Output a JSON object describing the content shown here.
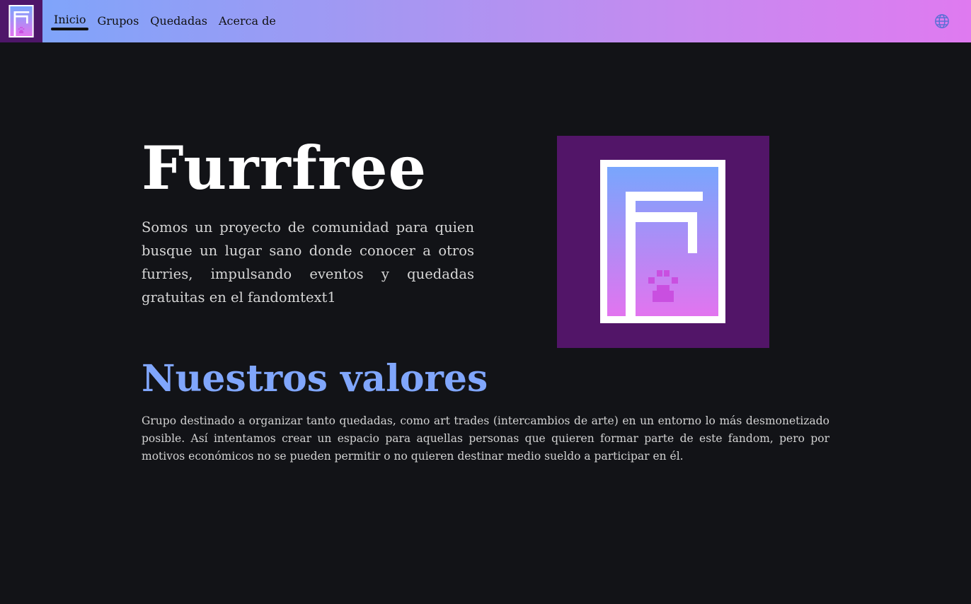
{
  "nav": {
    "items": [
      {
        "label": "Inicio",
        "active": true
      },
      {
        "label": "Grupos"
      },
      {
        "label": "Quedadas"
      },
      {
        "label": "Acerca de"
      }
    ],
    "language_icon": "globe-icon",
    "logo_icon": "furrfree-logo-icon"
  },
  "hero": {
    "title": "Furrfree",
    "description": "Somos un proyecto de comunidad para quien busque un lugar sano donde conocer a otros furries, impulsando eventos y quedadas gratuitas en el fandomtext1",
    "image_icon": "furrfree-logo-icon"
  },
  "values": {
    "title": "Nuestros valores",
    "text": "Grupo destinado a organizar tanto quedadas, como art trades (intercambios de arte) en un entorno lo más desmonetizado posible. Así intentamos crear un espacio para aquellas personas que quieren formar parte de este fandom, pero por motivos económicos no se pueden permitir o no quieren destinar medio sueldo a participar en él."
  },
  "colors": {
    "background": "#121317",
    "accent_blue": "#80a6fc",
    "accent_pink": "#df7af0",
    "logo_purple": "#521568"
  }
}
